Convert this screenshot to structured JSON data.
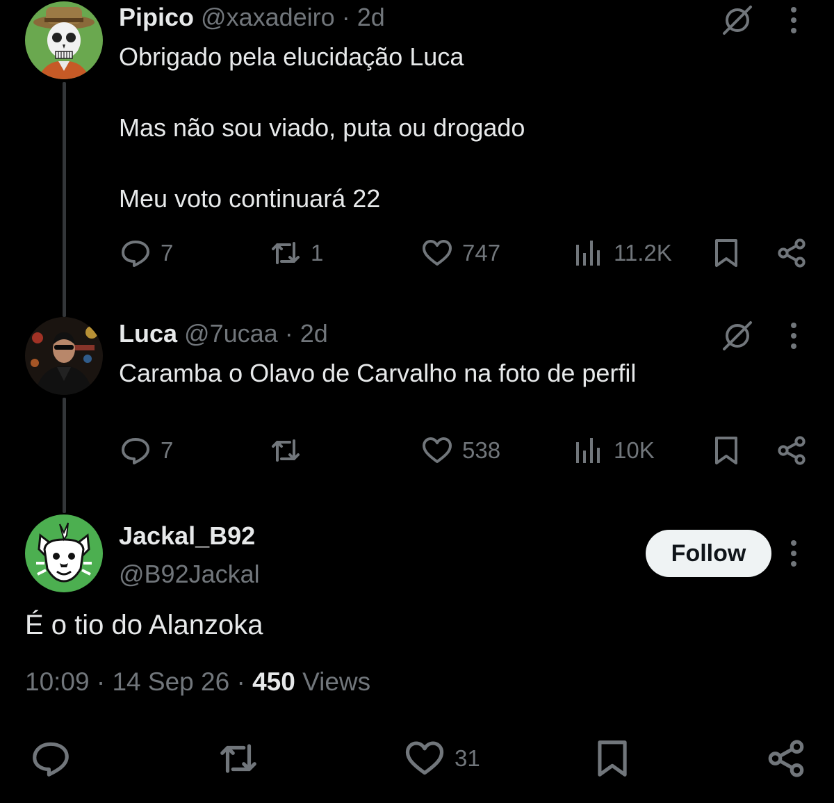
{
  "tweets": [
    {
      "name": "Pipico",
      "handle": "@xaxadeiro",
      "separator": "·",
      "time": "2d",
      "text": "Obrigado pela elucidação Luca\n\nMas não sou viado, puta ou drogado\n\nMeu voto continuará 22",
      "replies": "7",
      "retweets": "1",
      "likes": "747",
      "views": "11.2K"
    },
    {
      "name": "Luca",
      "handle": "@7ucaa",
      "separator": "·",
      "time": "2d",
      "text": "Caramba o Olavo de Carvalho na foto de perfil",
      "replies": "7",
      "retweets": "",
      "likes": "538",
      "views": "10K"
    }
  ],
  "main_tweet": {
    "name": "Jackal_B92",
    "handle": "@B92Jackal",
    "follow_label": "Follow",
    "text": "É o tio do Alanzoka",
    "time": "10:09",
    "separator": "·",
    "date": "14 Sep 26",
    "views_count": "450",
    "views_label": "Views",
    "likes": "31"
  },
  "colors": {
    "background": "#000000",
    "text_primary": "#e7e9ea",
    "text_secondary": "#71767b",
    "thread_line": "#333639",
    "follow_bg": "#eff3f4"
  },
  "icons": [
    "grok-icon",
    "more-icon",
    "reply-icon",
    "retweet-icon",
    "like-icon",
    "views-icon",
    "bookmark-icon",
    "share-icon"
  ]
}
